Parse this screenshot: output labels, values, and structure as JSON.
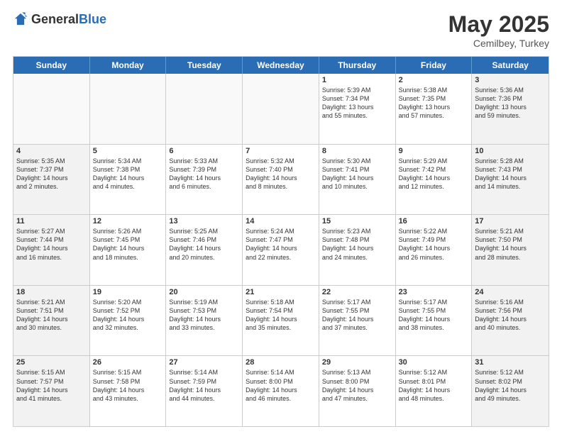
{
  "header": {
    "logo_general": "General",
    "logo_blue": "Blue",
    "title": "May 2025",
    "location": "Cemilbey, Turkey"
  },
  "calendar": {
    "weekdays": [
      "Sunday",
      "Monday",
      "Tuesday",
      "Wednesday",
      "Thursday",
      "Friday",
      "Saturday"
    ],
    "weeks": [
      [
        {
          "day": "",
          "text": "",
          "empty": true
        },
        {
          "day": "",
          "text": "",
          "empty": true
        },
        {
          "day": "",
          "text": "",
          "empty": true
        },
        {
          "day": "",
          "text": "",
          "empty": true
        },
        {
          "day": "1",
          "text": "Sunrise: 5:39 AM\nSunset: 7:34 PM\nDaylight: 13 hours\nand 55 minutes."
        },
        {
          "day": "2",
          "text": "Sunrise: 5:38 AM\nSunset: 7:35 PM\nDaylight: 13 hours\nand 57 minutes."
        },
        {
          "day": "3",
          "text": "Sunrise: 5:36 AM\nSunset: 7:36 PM\nDaylight: 13 hours\nand 59 minutes."
        }
      ],
      [
        {
          "day": "4",
          "text": "Sunrise: 5:35 AM\nSunset: 7:37 PM\nDaylight: 14 hours\nand 2 minutes."
        },
        {
          "day": "5",
          "text": "Sunrise: 5:34 AM\nSunset: 7:38 PM\nDaylight: 14 hours\nand 4 minutes."
        },
        {
          "day": "6",
          "text": "Sunrise: 5:33 AM\nSunset: 7:39 PM\nDaylight: 14 hours\nand 6 minutes."
        },
        {
          "day": "7",
          "text": "Sunrise: 5:32 AM\nSunset: 7:40 PM\nDaylight: 14 hours\nand 8 minutes."
        },
        {
          "day": "8",
          "text": "Sunrise: 5:30 AM\nSunset: 7:41 PM\nDaylight: 14 hours\nand 10 minutes."
        },
        {
          "day": "9",
          "text": "Sunrise: 5:29 AM\nSunset: 7:42 PM\nDaylight: 14 hours\nand 12 minutes."
        },
        {
          "day": "10",
          "text": "Sunrise: 5:28 AM\nSunset: 7:43 PM\nDaylight: 14 hours\nand 14 minutes."
        }
      ],
      [
        {
          "day": "11",
          "text": "Sunrise: 5:27 AM\nSunset: 7:44 PM\nDaylight: 14 hours\nand 16 minutes."
        },
        {
          "day": "12",
          "text": "Sunrise: 5:26 AM\nSunset: 7:45 PM\nDaylight: 14 hours\nand 18 minutes."
        },
        {
          "day": "13",
          "text": "Sunrise: 5:25 AM\nSunset: 7:46 PM\nDaylight: 14 hours\nand 20 minutes."
        },
        {
          "day": "14",
          "text": "Sunrise: 5:24 AM\nSunset: 7:47 PM\nDaylight: 14 hours\nand 22 minutes."
        },
        {
          "day": "15",
          "text": "Sunrise: 5:23 AM\nSunset: 7:48 PM\nDaylight: 14 hours\nand 24 minutes."
        },
        {
          "day": "16",
          "text": "Sunrise: 5:22 AM\nSunset: 7:49 PM\nDaylight: 14 hours\nand 26 minutes."
        },
        {
          "day": "17",
          "text": "Sunrise: 5:21 AM\nSunset: 7:50 PM\nDaylight: 14 hours\nand 28 minutes."
        }
      ],
      [
        {
          "day": "18",
          "text": "Sunrise: 5:21 AM\nSunset: 7:51 PM\nDaylight: 14 hours\nand 30 minutes."
        },
        {
          "day": "19",
          "text": "Sunrise: 5:20 AM\nSunset: 7:52 PM\nDaylight: 14 hours\nand 32 minutes."
        },
        {
          "day": "20",
          "text": "Sunrise: 5:19 AM\nSunset: 7:53 PM\nDaylight: 14 hours\nand 33 minutes."
        },
        {
          "day": "21",
          "text": "Sunrise: 5:18 AM\nSunset: 7:54 PM\nDaylight: 14 hours\nand 35 minutes."
        },
        {
          "day": "22",
          "text": "Sunrise: 5:17 AM\nSunset: 7:55 PM\nDaylight: 14 hours\nand 37 minutes."
        },
        {
          "day": "23",
          "text": "Sunrise: 5:17 AM\nSunset: 7:55 PM\nDaylight: 14 hours\nand 38 minutes."
        },
        {
          "day": "24",
          "text": "Sunrise: 5:16 AM\nSunset: 7:56 PM\nDaylight: 14 hours\nand 40 minutes."
        }
      ],
      [
        {
          "day": "25",
          "text": "Sunrise: 5:15 AM\nSunset: 7:57 PM\nDaylight: 14 hours\nand 41 minutes."
        },
        {
          "day": "26",
          "text": "Sunrise: 5:15 AM\nSunset: 7:58 PM\nDaylight: 14 hours\nand 43 minutes."
        },
        {
          "day": "27",
          "text": "Sunrise: 5:14 AM\nSunset: 7:59 PM\nDaylight: 14 hours\nand 44 minutes."
        },
        {
          "day": "28",
          "text": "Sunrise: 5:14 AM\nSunset: 8:00 PM\nDaylight: 14 hours\nand 46 minutes."
        },
        {
          "day": "29",
          "text": "Sunrise: 5:13 AM\nSunset: 8:00 PM\nDaylight: 14 hours\nand 47 minutes."
        },
        {
          "day": "30",
          "text": "Sunrise: 5:12 AM\nSunset: 8:01 PM\nDaylight: 14 hours\nand 48 minutes."
        },
        {
          "day": "31",
          "text": "Sunrise: 5:12 AM\nSunset: 8:02 PM\nDaylight: 14 hours\nand 49 minutes."
        }
      ]
    ]
  }
}
